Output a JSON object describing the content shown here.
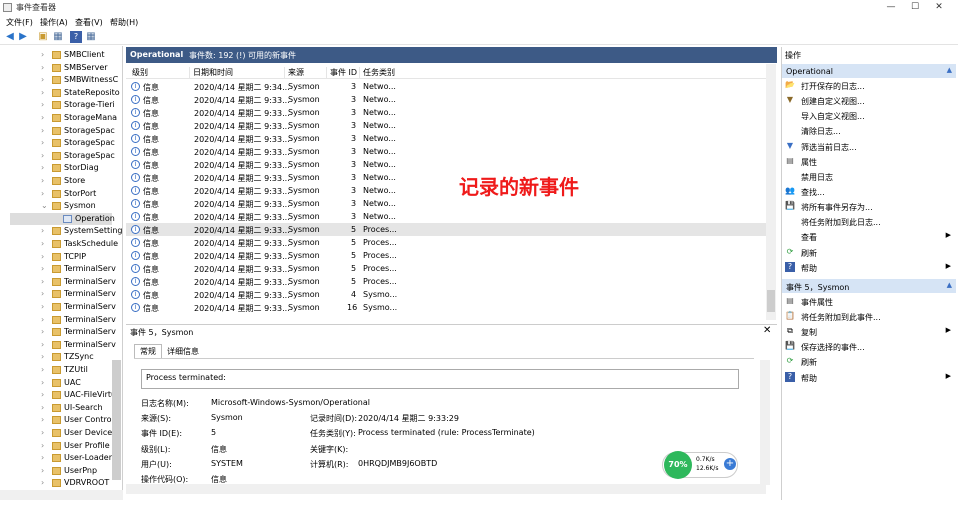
{
  "window": {
    "title": "事件查看器",
    "controls": [
      "—",
      "☐",
      "✕"
    ]
  },
  "menu": [
    "文件(F)",
    "操作(A)",
    "查看(V)",
    "帮助(H)"
  ],
  "tree": [
    {
      "label": "SMBClient",
      "expand": "›"
    },
    {
      "label": "SMBServer",
      "expand": "›"
    },
    {
      "label": "SMBWitnessC",
      "expand": "›"
    },
    {
      "label": "StateReposito",
      "expand": "›"
    },
    {
      "label": "Storage-Tieri",
      "expand": "›"
    },
    {
      "label": "StorageMana",
      "expand": "›"
    },
    {
      "label": "StorageSpac",
      "expand": "›"
    },
    {
      "label": "StorageSpac",
      "expand": "›"
    },
    {
      "label": "StorageSpac",
      "expand": "›"
    },
    {
      "label": "StorDiag",
      "expand": "›"
    },
    {
      "label": "Store",
      "expand": "›"
    },
    {
      "label": "StorPort",
      "expand": "›"
    },
    {
      "label": "Sysmon",
      "expand": "⌄"
    },
    {
      "label": "Operation",
      "expand": ""
    },
    {
      "label": "SystemSetting",
      "expand": "›"
    },
    {
      "label": "TaskSchedule",
      "expand": "›"
    },
    {
      "label": "TCPIP",
      "expand": "›"
    },
    {
      "label": "TerminalServ",
      "expand": "›"
    },
    {
      "label": "TerminalServ",
      "expand": "›"
    },
    {
      "label": "TerminalServ",
      "expand": "›"
    },
    {
      "label": "TerminalServ",
      "expand": "›"
    },
    {
      "label": "TerminalServ",
      "expand": "›"
    },
    {
      "label": "TerminalServ",
      "expand": "›"
    },
    {
      "label": "TerminalServ",
      "expand": "›"
    },
    {
      "label": "TZSync",
      "expand": "›"
    },
    {
      "label": "TZUtil",
      "expand": "›"
    },
    {
      "label": "UAC",
      "expand": "›"
    },
    {
      "label": "UAC-FileVirtu",
      "expand": "›"
    },
    {
      "label": "UI-Search",
      "expand": "›"
    },
    {
      "label": "User Control",
      "expand": "›"
    },
    {
      "label": "User Device F",
      "expand": "›"
    },
    {
      "label": "User Profile S",
      "expand": "›"
    },
    {
      "label": "User-Loader",
      "expand": "›"
    },
    {
      "label": "UserPnp",
      "expand": "›"
    },
    {
      "label": "VDRVROOT",
      "expand": "›"
    }
  ],
  "events_header": {
    "log_name": "Operational",
    "count_text": "事件数: 192 (!) 可用的新事件"
  },
  "columns": [
    "级别",
    "日期和时间",
    "来源",
    "事件 ID",
    "任务类别"
  ],
  "events": [
    {
      "level": "信息",
      "date": "2020/4/14 星期二 9:34...",
      "source": "Sysmon",
      "id": "3",
      "task": "Netwo..."
    },
    {
      "level": "信息",
      "date": "2020/4/14 星期二 9:33...",
      "source": "Sysmon",
      "id": "3",
      "task": "Netwo..."
    },
    {
      "level": "信息",
      "date": "2020/4/14 星期二 9:33...",
      "source": "Sysmon",
      "id": "3",
      "task": "Netwo..."
    },
    {
      "level": "信息",
      "date": "2020/4/14 星期二 9:33...",
      "source": "Sysmon",
      "id": "3",
      "task": "Netwo..."
    },
    {
      "level": "信息",
      "date": "2020/4/14 星期二 9:33...",
      "source": "Sysmon",
      "id": "3",
      "task": "Netwo..."
    },
    {
      "level": "信息",
      "date": "2020/4/14 星期二 9:33...",
      "source": "Sysmon",
      "id": "3",
      "task": "Netwo..."
    },
    {
      "level": "信息",
      "date": "2020/4/14 星期二 9:33...",
      "source": "Sysmon",
      "id": "3",
      "task": "Netwo..."
    },
    {
      "level": "信息",
      "date": "2020/4/14 星期二 9:33...",
      "source": "Sysmon",
      "id": "3",
      "task": "Netwo..."
    },
    {
      "level": "信息",
      "date": "2020/4/14 星期二 9:33...",
      "source": "Sysmon",
      "id": "3",
      "task": "Netwo..."
    },
    {
      "level": "信息",
      "date": "2020/4/14 星期二 9:33...",
      "source": "Sysmon",
      "id": "3",
      "task": "Netwo..."
    },
    {
      "level": "信息",
      "date": "2020/4/14 星期二 9:33...",
      "source": "Sysmon",
      "id": "3",
      "task": "Netwo..."
    },
    {
      "level": "信息",
      "date": "2020/4/14 星期二 9:33...",
      "source": "Sysmon",
      "id": "5",
      "task": "Proces..."
    },
    {
      "level": "信息",
      "date": "2020/4/14 星期二 9:33...",
      "source": "Sysmon",
      "id": "5",
      "task": "Proces..."
    },
    {
      "level": "信息",
      "date": "2020/4/14 星期二 9:33...",
      "source": "Sysmon",
      "id": "5",
      "task": "Proces..."
    },
    {
      "level": "信息",
      "date": "2020/4/14 星期二 9:33...",
      "source": "Sysmon",
      "id": "5",
      "task": "Proces..."
    },
    {
      "level": "信息",
      "date": "2020/4/14 星期二 9:33...",
      "source": "Sysmon",
      "id": "5",
      "task": "Proces..."
    },
    {
      "level": "信息",
      "date": "2020/4/14 星期二 9:33...",
      "source": "Sysmon",
      "id": "4",
      "task": "Sysmo..."
    },
    {
      "level": "信息",
      "date": "2020/4/14 星期二 9:33...",
      "source": "Sysmon",
      "id": "16",
      "task": "Sysmo..."
    }
  ],
  "selected_event_index": 11,
  "annotation": "记录的新事件",
  "detail": {
    "title": "事件 5，Sysmon",
    "tabs": [
      "常规",
      "详细信息"
    ],
    "description": "Process terminated:",
    "fields": {
      "log_name_label": "日志名称(M):",
      "log_name_value": "Microsoft-Windows-Sysmon/Operational",
      "source_label": "来源(S):",
      "source_value": "Sysmon",
      "logged_label": "记录时间(D):",
      "logged_value": "2020/4/14 星期二 9:33:29",
      "event_id_label": "事件 ID(E):",
      "event_id_value": "5",
      "task_label": "任务类别(Y):",
      "task_value": "Process terminated (rule: ProcessTerminate)",
      "level_label": "级别(L):",
      "level_value": "信息",
      "keywords_label": "关键字(K):",
      "keywords_value": "",
      "user_label": "用户(U):",
      "user_value": "SYSTEM",
      "computer_label": "计算机(R):",
      "computer_value": "0HRQDJMB9J6OBTD",
      "opcode_label": "操作代码(O):",
      "opcode_value": "信息"
    }
  },
  "net_widget": {
    "percent": "70%",
    "up": "0.7K/s",
    "down": "12.6K/s"
  },
  "actions": {
    "title": "操作",
    "section1": {
      "title": "Operational",
      "items": [
        {
          "label": "打开保存的日志...",
          "icon": "open-log-icon",
          "glyph": "📂",
          "arrow": ""
        },
        {
          "label": "创建自定义视图...",
          "icon": "filter-icon",
          "glyph": "▼",
          "arrow": ""
        },
        {
          "label": "导入自定义视图...",
          "icon": "",
          "glyph": "",
          "arrow": ""
        },
        {
          "label": "清除日志...",
          "icon": "",
          "glyph": "",
          "arrow": ""
        },
        {
          "label": "筛选当前日志...",
          "icon": "filter-icon",
          "glyph": "▼",
          "arrow": ""
        },
        {
          "label": "属性",
          "icon": "properties-icon",
          "glyph": "▤",
          "arrow": ""
        },
        {
          "label": "禁用日志",
          "icon": "",
          "glyph": "",
          "arrow": ""
        },
        {
          "label": "查找...",
          "icon": "find-icon",
          "glyph": "👥",
          "arrow": ""
        },
        {
          "label": "将所有事件另存为...",
          "icon": "save-icon",
          "glyph": "💾",
          "arrow": ""
        },
        {
          "label": "将任务附加到此日志...",
          "icon": "",
          "glyph": "",
          "arrow": ""
        },
        {
          "label": "查看",
          "icon": "",
          "glyph": "",
          "arrow": "▶"
        },
        {
          "label": "刷新",
          "icon": "refresh-icon",
          "glyph": "⟳",
          "arrow": ""
        },
        {
          "label": "帮助",
          "icon": "help-icon",
          "glyph": "?",
          "arrow": "▶"
        }
      ]
    },
    "section2": {
      "title": "事件 5，Sysmon",
      "items": [
        {
          "label": "事件属性",
          "icon": "event-properties-icon",
          "glyph": "▤",
          "arrow": ""
        },
        {
          "label": "将任务附加到此事件...",
          "icon": "task-icon",
          "glyph": "📋",
          "arrow": ""
        },
        {
          "label": "复制",
          "icon": "copy-icon",
          "glyph": "⧉",
          "arrow": "▶"
        },
        {
          "label": "保存选择的事件...",
          "icon": "save-icon",
          "glyph": "💾",
          "arrow": ""
        },
        {
          "label": "刷新",
          "icon": "refresh-icon",
          "glyph": "⟳",
          "arrow": ""
        },
        {
          "label": "帮助",
          "icon": "help-icon",
          "glyph": "?",
          "arrow": "▶"
        }
      ]
    }
  }
}
